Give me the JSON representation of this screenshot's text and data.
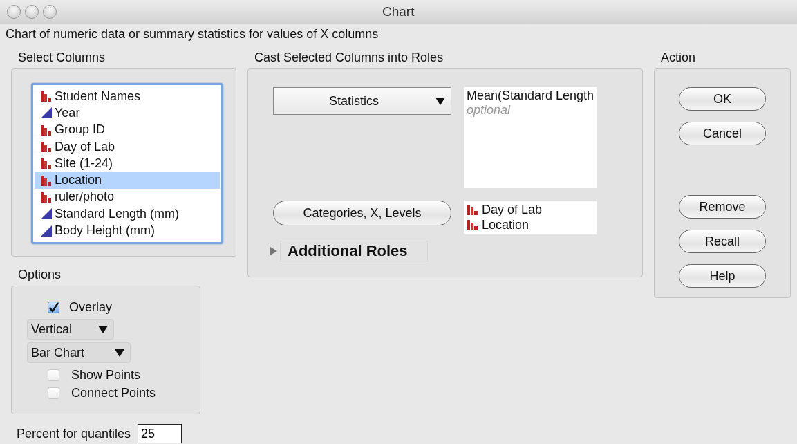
{
  "window": {
    "title": "Chart"
  },
  "description": "Chart of numeric data or summary statistics for values of X columns",
  "select_columns": {
    "label": "Select Columns",
    "columns": [
      {
        "name": "Student Names",
        "kind": "nominal",
        "selected": false
      },
      {
        "name": "Year",
        "kind": "continuous",
        "selected": false
      },
      {
        "name": "Group ID",
        "kind": "nominal",
        "selected": false
      },
      {
        "name": "Day of Lab",
        "kind": "nominal",
        "selected": false
      },
      {
        "name": "Site (1-24)",
        "kind": "nominal",
        "selected": false
      },
      {
        "name": "Location",
        "kind": "nominal",
        "selected": true
      },
      {
        "name": "ruler/photo",
        "kind": "nominal",
        "selected": false
      },
      {
        "name": "Standard Length (mm)",
        "kind": "continuous",
        "selected": false
      },
      {
        "name": "Body Height (mm)",
        "kind": "continuous",
        "selected": false
      }
    ]
  },
  "roles": {
    "label": "Cast Selected Columns into Roles",
    "statistics": {
      "value": "Statistics",
      "items": [
        "Mean(Standard Length"
      ],
      "placeholder": "optional"
    },
    "categories": {
      "button": "Categories, X, Levels",
      "items": [
        {
          "name": "Day of Lab",
          "kind": "nominal"
        },
        {
          "name": "Location",
          "kind": "nominal"
        }
      ]
    },
    "additional": {
      "label": "Additional Roles",
      "expanded": false
    }
  },
  "action": {
    "label": "Action",
    "primary": [
      "OK",
      "Cancel"
    ],
    "secondary": [
      "Remove",
      "Recall",
      "Help"
    ]
  },
  "options": {
    "label": "Options",
    "overlay": {
      "label": "Overlay",
      "checked": true
    },
    "orientation": "Vertical",
    "chart_type": "Bar Chart",
    "points": [
      {
        "label": "Show Points",
        "checked": false
      },
      {
        "label": "Connect Points",
        "checked": false
      }
    ]
  },
  "quantiles": {
    "label": "Percent for quantiles",
    "value": "25"
  }
}
